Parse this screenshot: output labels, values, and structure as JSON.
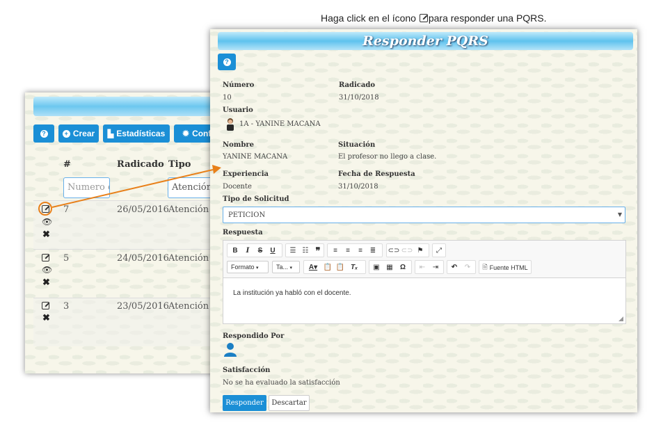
{
  "caption": {
    "before": "Haga click en el ícono",
    "after": "para responder una PQRS."
  },
  "back_window": {
    "buttons": {
      "help": "?",
      "crear": "Crear",
      "estadisticas": "Estadísticas",
      "config": "Confi"
    },
    "columns": [
      "#",
      "Radicado",
      "Tipo"
    ],
    "filters": {
      "numero_placeholder": "Numero d",
      "tipo_value": "Atención"
    },
    "rows": [
      {
        "num": "7",
        "radicado": "26/05/2016",
        "tipo": "Atención de"
      },
      {
        "num": "5",
        "radicado": "24/05/2016",
        "tipo": "Atención de"
      },
      {
        "num": "3",
        "radicado": "23/05/2016",
        "tipo": "Atención de"
      }
    ]
  },
  "front_window": {
    "title": "Responder PQRS",
    "help": "?",
    "fields": {
      "numero_label": "Número",
      "numero": "10",
      "radicado_label": "Radicado",
      "radicado": "31/10/2018",
      "usuario_label": "Usuario",
      "usuario": "1A - YANINE MACANA",
      "nombre_label": "Nombre",
      "nombre": "YANINE MACANA",
      "situacion_label": "Situación",
      "situacion": "El profesor no llego a clase.",
      "experiencia_label": "Experiencia",
      "experiencia": "Docente",
      "fecha_label": "Fecha de Respuesta",
      "fecha": "31/10/2018",
      "tipo_label": "Tipo de Solicitud",
      "tipo": "PETICION",
      "respuesta_label": "Respuesta",
      "respondido_label": "Respondido Por",
      "satisfaccion_label": "Satisfacción",
      "satisfaccion": "No se ha evaluado la satisfacción"
    },
    "editor": {
      "formato": "Formato",
      "tamano": "Ta...",
      "source": "Fuente HTML",
      "content": "La institución ya habló con el docente."
    },
    "buttons": {
      "responder": "Responder",
      "descartar": "Descartar"
    }
  },
  "colors": {
    "accent": "#1b8fd6",
    "highlight": "#e8801a",
    "header_gradient": "#6cc7ef"
  }
}
